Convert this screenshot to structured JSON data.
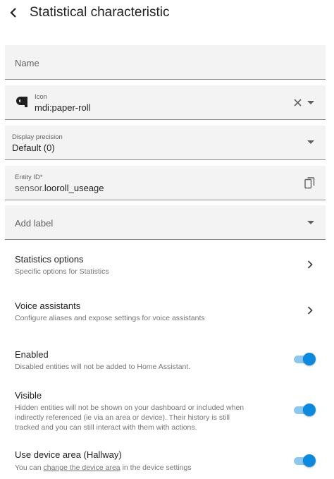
{
  "header": {
    "title": "Statistical characteristic"
  },
  "name_field": {
    "placeholder": "Name"
  },
  "icon_field": {
    "label": "Icon",
    "value": "mdi:paper-roll"
  },
  "precision_field": {
    "label": "Display precision",
    "value": "Default (0)"
  },
  "entity_field": {
    "label": "Entity ID*",
    "prefix": "sensor.",
    "value": "looroll_useage"
  },
  "label_field": {
    "placeholder": "Add label"
  },
  "statistics_options": {
    "title": "Statistics options",
    "subtitle": "Specific options for Statistics"
  },
  "voice_assistants": {
    "title": "Voice assistants",
    "subtitle": "Configure aliases and expose settings for voice assistants"
  },
  "enabled": {
    "title": "Enabled",
    "subtitle": "Disabled entities will not be added to Home Assistant.",
    "on": true
  },
  "visible": {
    "title": "Visible",
    "subtitle_line1": "Hidden entities will not be shown on your dashboard or included when",
    "subtitle_line2": "indirectly referenced (ie via an area or device). Their history is still",
    "subtitle_line3": "tracked and you can still interact with them with actions.",
    "on": true
  },
  "device_area": {
    "title": "Use device area (Hallway)",
    "subtitle_before": "You can ",
    "subtitle_link": "change the device area",
    "subtitle_after": " in the device settings",
    "on": true
  },
  "colors": {
    "accent": "#0b8ae0",
    "accent_track": "#8cc7ef",
    "field_bg": "#f3f3f3"
  }
}
